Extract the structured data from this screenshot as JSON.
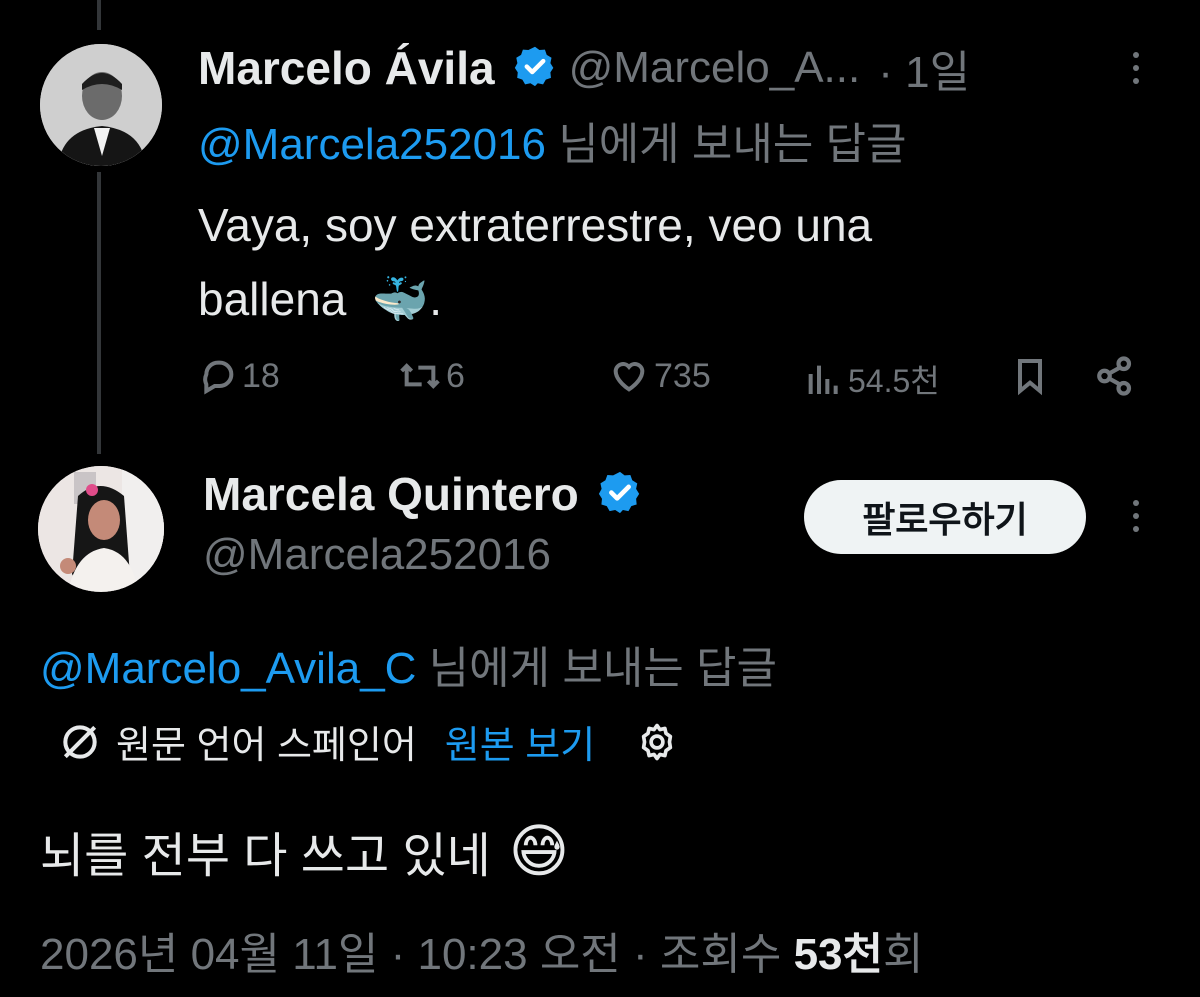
{
  "parent_tweet": {
    "author_name": "Marcelo Ávila",
    "handle": "@Marcelo_A...",
    "time": "· 1일",
    "reply_to_handle": "@Marcela252016",
    "reply_to_suffix": " 님에게 보내는 답글",
    "text_line1": "Vaya, soy extraterrestre, veo una",
    "text_line2": "ballena",
    "text_emoji": "🐳",
    "text_end": ".",
    "replies": "18",
    "retweets": "6",
    "likes": "735",
    "views": "54.5천"
  },
  "main_tweet": {
    "author_name": "Marcela Quintero",
    "handle": "@Marcela252016",
    "follow_label": "팔로우하기",
    "reply_to_handle": "@Marcelo_Avila_C",
    "reply_to_suffix": " 님에게 보내는 답글",
    "translation_note": "원문 언어 스페인어",
    "show_original": "원본 보기",
    "text": "뇌를 전부 다 쓰고 있네",
    "text_emoji": "😅",
    "date": "2026년 04월 11일 · 10:23 오전 · 조회수 ",
    "view_count": "53천",
    "view_suffix": "회"
  },
  "colors": {
    "background": "#000000",
    "text": "#e7e9ea",
    "muted": "#71767b",
    "link": "#1d9bf0",
    "verified": "#1d9bf0"
  },
  "icons": [
    "verified-badge-icon",
    "more-icon",
    "reply-icon",
    "retweet-icon",
    "like-icon",
    "views-icon",
    "bookmark-icon",
    "share-icon",
    "translate-icon",
    "settings-gear-icon",
    "whale-emoji",
    "sweat-smile-emoji"
  ]
}
